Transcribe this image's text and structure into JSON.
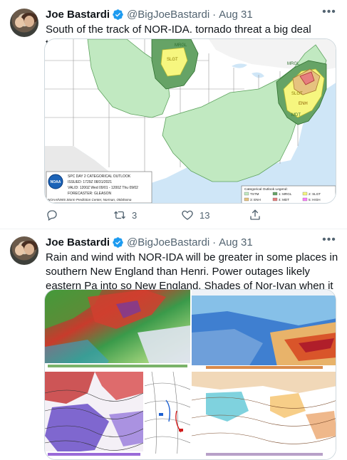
{
  "tweets": [
    {
      "author_name": "Joe Bastardi",
      "handle": "@BigJoeBastardi",
      "separator": "·",
      "date": "Aug 31",
      "text": "South of the track of NOR-IDA. tornado threat a big deal tomorrow",
      "media": {
        "map": {
          "outlook_title": "SPC DAY 2 CATEGORICAL OUTLOOK",
          "issued": "ISSUED: 1729Z 08/31/2021",
          "valid": "VALID: 1200Z Wed 09/01 - 1200Z Thu 09/02",
          "forecaster": "FORECASTER: GLEASON",
          "agency": "NOAA/NWS Storm Prediction Center, Norman, Oklahoma",
          "logo_text": "NOAA",
          "labels": {
            "mrgl_north": "MRGL",
            "slgt_north": "SLGT",
            "mrgl_east": "MRGL",
            "slgt_east": "SLGT",
            "enh_east": "ENH",
            "mdt_east": "MDT"
          },
          "legend": {
            "title": "Categorical Outlook Legend:",
            "items": [
              {
                "label": "TSTM",
                "color": "#c1e9c1"
              },
              {
                "label": "1: MRGL",
                "color": "#66a366"
              },
              {
                "label": "2: SLGT",
                "color": "#f6f67f"
              },
              {
                "label": "3: ENH",
                "color": "#e6c27f"
              },
              {
                "label": "4: MDT",
                "color": "#e67f7f"
              },
              {
                "label": "5: HIGH",
                "color": "#ff7fff"
              }
            ]
          }
        }
      },
      "actions": {
        "reply_count": "",
        "retweet_count": "3",
        "like_count": "13"
      }
    },
    {
      "author_name": "Joe Bastardi",
      "handle": "@BigJoeBastardi",
      "separator": "·",
      "date": "Aug 31",
      "text": "Rain and wind with NOR-IDA will be greater in some places in southern New England than Henri.  Power outages likely eastern Pa into so New England. Shades of Nor-Ivan when it came off the coast"
    }
  ],
  "colors": {
    "verified": "#1d9bf0",
    "muted": "#536471",
    "border": "#cfd9de",
    "tstm": "#c1e9c1",
    "mrgl": "#66a366",
    "slgt": "#f6f67f",
    "enh": "#e6c27f",
    "mdt": "#e67f7f"
  }
}
